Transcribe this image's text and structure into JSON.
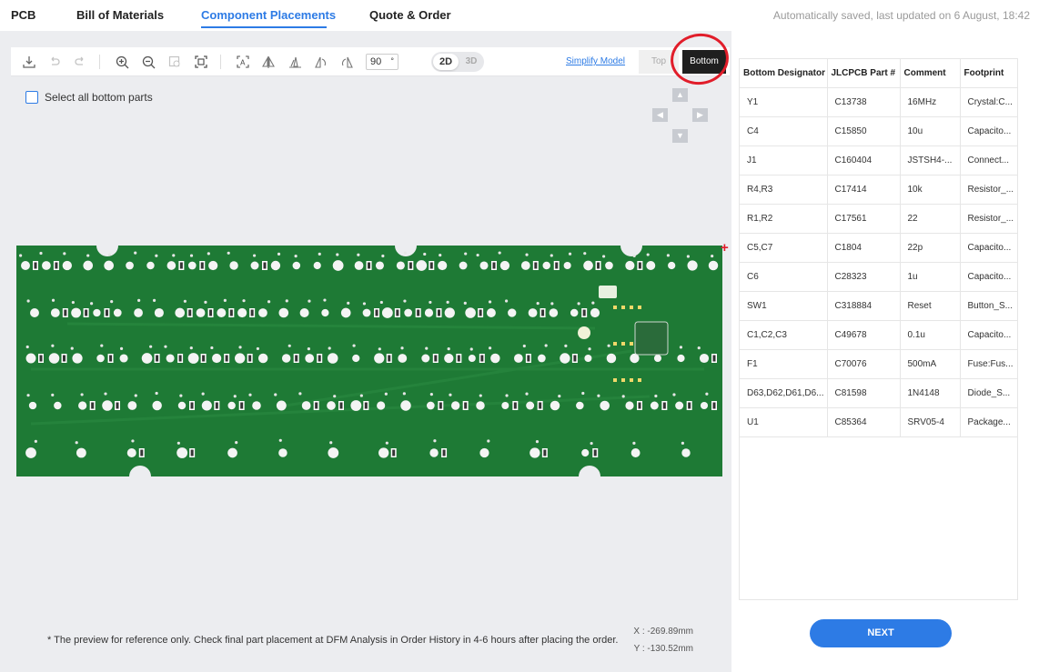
{
  "nav": {
    "tabs": [
      {
        "label": "PCB"
      },
      {
        "label": "Bill of Materials"
      },
      {
        "label": "Component Placements"
      },
      {
        "label": "Quote & Order"
      }
    ],
    "active_tab": "Component Placements",
    "saved_status": "Automatically saved, last updated on 6 August, 18:42"
  },
  "toolbar": {
    "rotation_value": "90",
    "rotation_unit": "°",
    "view_2d": "2D",
    "view_3d": "3D",
    "simplify_label": "Simplify Model",
    "side_top": "Top",
    "side_bottom": "Bottom",
    "active_side": "Bottom",
    "icons": [
      "download-icon",
      "undo-icon",
      "redo-icon",
      "zoom-in-icon",
      "zoom-out-icon",
      "zoom-area-icon",
      "fit-screen-icon",
      "text-icon",
      "flip-horizontal-icon",
      "flip-vertical-icon",
      "rotate-left-icon",
      "rotate-right-icon"
    ]
  },
  "canvas": {
    "select_all_label": "Select all bottom parts",
    "note": "* The preview for reference only. Check final part placement at DFM Analysis in Order History in 4-6 hours after placing the order.",
    "coord_x": "X : -269.89mm",
    "coord_y": "Y : -130.52mm",
    "board_color": "#1e7a35",
    "annotation_color": "#e11d2a"
  },
  "table": {
    "headers": [
      "Bottom Designator",
      "JLCPCB Part #",
      "Comment",
      "Footprint"
    ],
    "rows": [
      [
        "Y1",
        "C13738",
        "16MHz",
        "Crystal:C..."
      ],
      [
        "C4",
        "C15850",
        "10u",
        "Capacito..."
      ],
      [
        "J1",
        "C160404",
        "JSTSH4-...",
        "Connect..."
      ],
      [
        "R4,R3",
        "C17414",
        "10k",
        "Resistor_..."
      ],
      [
        "R1,R2",
        "C17561",
        "22",
        "Resistor_..."
      ],
      [
        "C5,C7",
        "C1804",
        "22p",
        "Capacito..."
      ],
      [
        "C6",
        "C28323",
        "1u",
        "Capacito..."
      ],
      [
        "SW1",
        "C318884",
        "Reset",
        "Button_S..."
      ],
      [
        "C1,C2,C3",
        "C49678",
        "0.1u",
        "Capacito..."
      ],
      [
        "F1",
        "C70076",
        "500mA",
        "Fuse:Fus..."
      ],
      [
        "D63,D62,D61,D6...",
        "C81598",
        "1N4148",
        "Diode_S..."
      ],
      [
        "U1",
        "C85364",
        "SRV05-4",
        "Package..."
      ]
    ]
  },
  "next_label": "NEXT",
  "accent_color": "#2d7be5"
}
